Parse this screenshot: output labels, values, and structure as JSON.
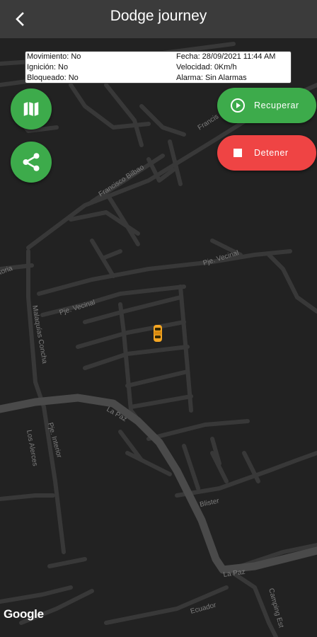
{
  "header": {
    "title": "Dodge journey",
    "back_icon": "chevron-left-icon"
  },
  "info_panel": {
    "movimiento": "Movimiento: No",
    "fecha": "Fecha: 28/09/2021 11:44 AM",
    "ignicion": "Ignición: No",
    "velocidad": "Velocidad: 0Km/h",
    "bloqueado": "Bloqueado: No",
    "alarma": "Alarma: Sin Alarmas"
  },
  "buttons": {
    "map_icon": "map-icon",
    "share_icon": "share-icon",
    "recuperar": "Recuperar",
    "detener": "Detener"
  },
  "map": {
    "attribution": "Google",
    "streets": [
      "Francisco Bilbao",
      "Francis",
      "Pje. Vecinal",
      "Pje. Vecinal",
      "Malaquías Concha",
      "La Paz",
      "La Paz",
      "Pje. Interior",
      "Los Alerces",
      "Blister",
      "Ecuador",
      "Camping Est",
      "toria"
    ]
  },
  "colors": {
    "accent_green": "#3dab4b",
    "stop_red": "#ef4444",
    "map_bg": "#222222",
    "vehicle": "#f5a623"
  }
}
